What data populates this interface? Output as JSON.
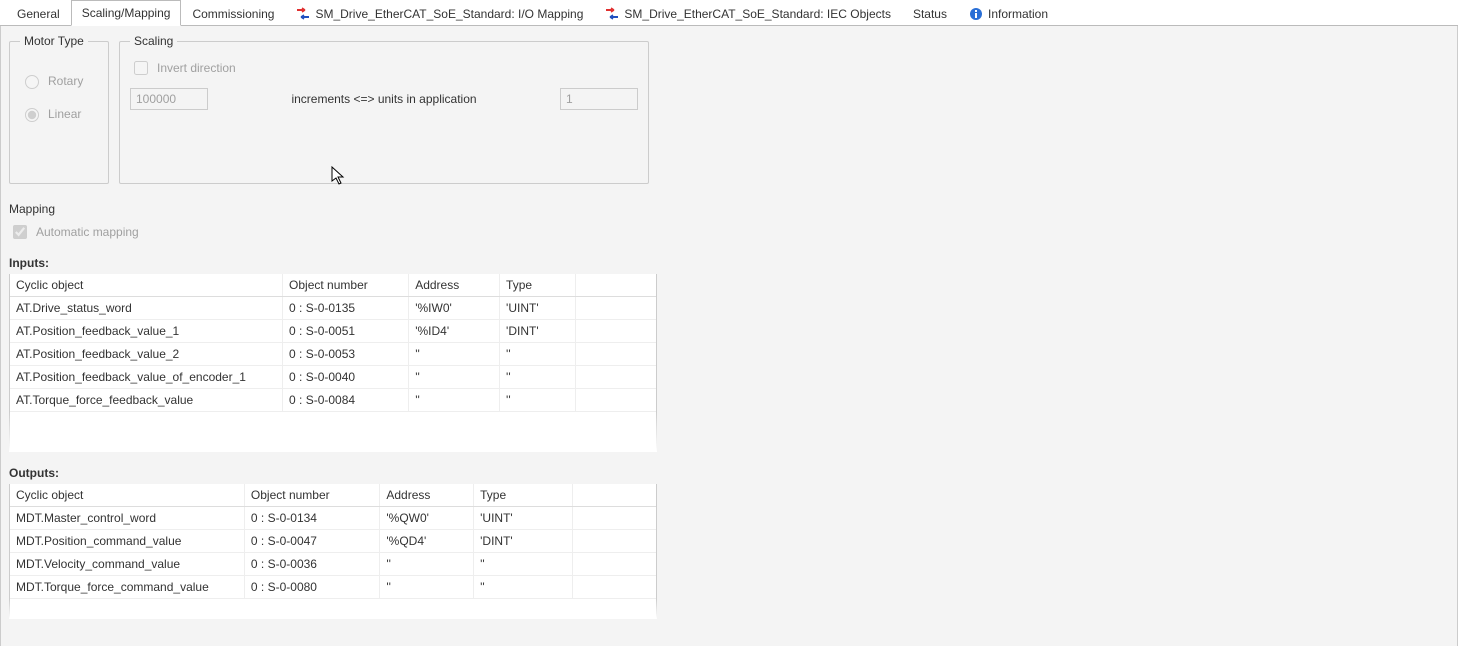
{
  "tabs": {
    "general": "General",
    "scaling": "Scaling/Mapping",
    "commissioning": "Commissioning",
    "io_mapping": "SM_Drive_EtherCAT_SoE_Standard: I/O Mapping",
    "iec_objects": "SM_Drive_EtherCAT_SoE_Standard: IEC Objects",
    "status": "Status",
    "information": "Information"
  },
  "motor_type": {
    "legend": "Motor Type",
    "rotary": "Rotary",
    "linear": "Linear",
    "selected": "linear"
  },
  "scaling": {
    "legend": "Scaling",
    "invert_label": "Invert direction",
    "invert_checked": false,
    "increments_value": "100000",
    "eq_label": "increments <=> units in application",
    "units_value": "1"
  },
  "mapping": {
    "legend": "Mapping",
    "auto_label": "Automatic mapping",
    "auto_checked": true,
    "inputs_label": "Inputs:",
    "outputs_label": "Outputs:",
    "columns": {
      "cyclic": "Cyclic object",
      "obj_num": "Object number",
      "address": "Address",
      "type": "Type"
    },
    "inputs": [
      {
        "cyclic": "AT.Drive_status_word",
        "obj_num": "0 : S-0-0135",
        "address": "'%IW0'",
        "type": "'UINT'"
      },
      {
        "cyclic": "AT.Position_feedback_value_1",
        "obj_num": "0 : S-0-0051",
        "address": "'%ID4'",
        "type": "'DINT'"
      },
      {
        "cyclic": "AT.Position_feedback_value_2",
        "obj_num": "0 : S-0-0053",
        "address": "''",
        "type": "''"
      },
      {
        "cyclic": "AT.Position_feedback_value_of_encoder_1",
        "obj_num": "0 : S-0-0040",
        "address": "''",
        "type": "''"
      },
      {
        "cyclic": "AT.Torque_force_feedback_value",
        "obj_num": "0 : S-0-0084",
        "address": "''",
        "type": "''"
      }
    ],
    "outputs": [
      {
        "cyclic": "MDT.Master_control_word",
        "obj_num": "0 : S-0-0134",
        "address": "'%QW0'",
        "type": "'UINT'"
      },
      {
        "cyclic": "MDT.Position_command_value",
        "obj_num": "0 : S-0-0047",
        "address": "'%QD4'",
        "type": "'DINT'"
      },
      {
        "cyclic": "MDT.Velocity_command_value",
        "obj_num": "0 : S-0-0036",
        "address": "''",
        "type": "''"
      },
      {
        "cyclic": "MDT.Torque_force_command_value",
        "obj_num": "0 : S-0-0080",
        "address": "''",
        "type": "''"
      }
    ]
  }
}
